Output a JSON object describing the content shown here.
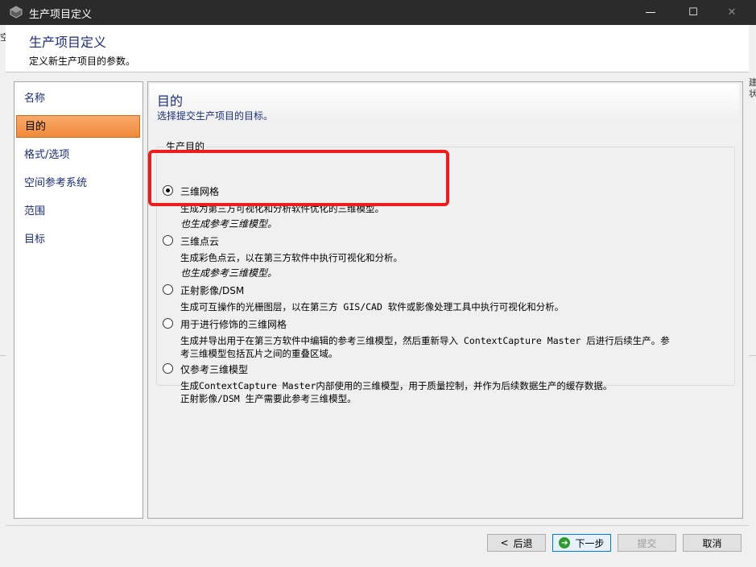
{
  "window": {
    "title": "生产项目定义",
    "controls": {
      "minimize": "—",
      "maximize": "☐",
      "close": "✕"
    }
  },
  "header": {
    "title": "生产项目定义",
    "subtitle": "定义新生产项目的参数。"
  },
  "nav": {
    "items": [
      {
        "label": "名称",
        "active": false
      },
      {
        "label": "目的",
        "active": true
      },
      {
        "label": "格式/选项",
        "active": false
      },
      {
        "label": "空间参考系统",
        "active": false
      },
      {
        "label": "范围",
        "active": false
      },
      {
        "label": "目标",
        "active": false
      }
    ]
  },
  "main": {
    "title": "目的",
    "subtitle": "选择提交生产项目的目标。",
    "group_label": "生产目的",
    "options": [
      {
        "label": "三维网格",
        "checked": true,
        "desc": [
          "生成为第三方可视化和分析软件优化的三维模型。"
        ],
        "note": "也生成参考三维模型。"
      },
      {
        "label": "三维点云",
        "checked": false,
        "desc": [
          "生成彩色点云，以在第三方软件中执行可视化和分析。"
        ],
        "note": "也生成参考三维模型。"
      },
      {
        "label": "正射影像/DSM",
        "checked": false,
        "desc": [
          "生成可互操作的光栅图层，以在第三方 GIS/CAD 软件或影像处理工具中执行可视化和分析。"
        ],
        "note": ""
      },
      {
        "label": "用于进行修饰的三维网格",
        "checked": false,
        "desc": [
          "生成并导出用于在第三方软件中编辑的参考三维模型，然后重新导入 ContextCapture Master 后进行后续生产。参",
          "考三维模型包括瓦片之间的重叠区域。"
        ],
        "note": ""
      },
      {
        "label": "仅参考三维模型",
        "checked": false,
        "desc": [
          "生成ContextCapture Master内部使用的三维模型，用于质量控制，并作为后续数据生产的缓存数据。",
          "正射影像/DSM 生产需要此参考三维模型。"
        ],
        "note": ""
      }
    ]
  },
  "footer": {
    "back": "后退",
    "next": "下一步",
    "submit": "提交",
    "cancel": "取消"
  },
  "background_fragments": {
    "left": "空",
    "right_top": "建",
    "right_bottom": "状"
  },
  "colors": {
    "accent_title": "#1a2d7a",
    "nav_active": "#f08a3a",
    "highlight": "#ee1c1c",
    "titlebar": "#2b2b2b"
  }
}
